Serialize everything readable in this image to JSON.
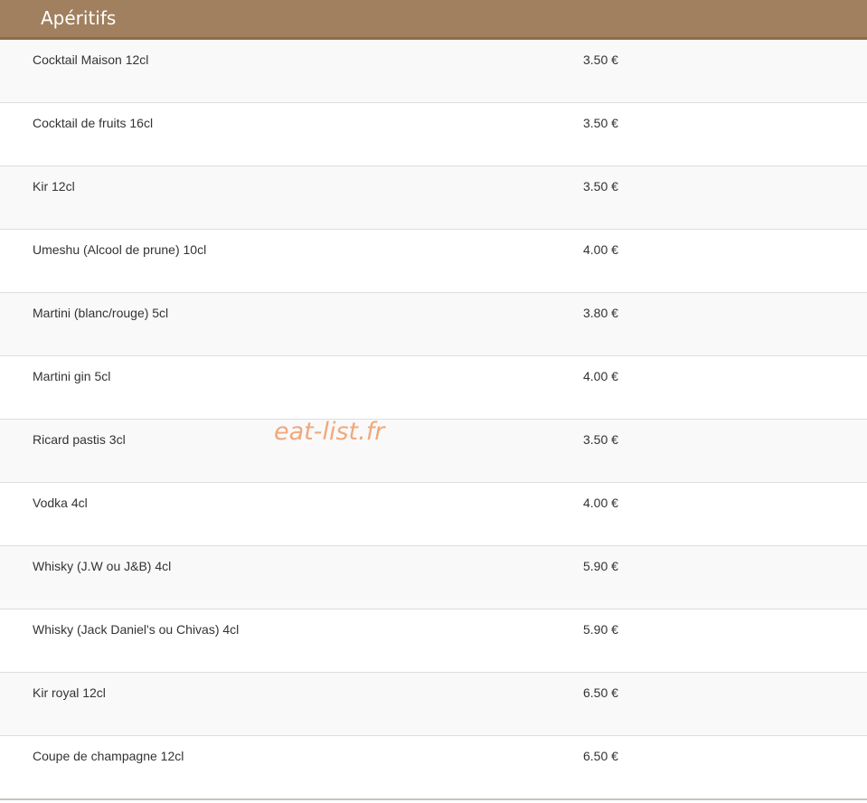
{
  "header": {
    "title": "Apéritifs"
  },
  "items": [
    {
      "name": "Cocktail Maison 12cl",
      "price": "3.50 €"
    },
    {
      "name": "Cocktail de fruits 16cl",
      "price": "3.50 €"
    },
    {
      "name": "Kir 12cl",
      "price": "3.50 €"
    },
    {
      "name": "Umeshu (Alcool de prune) 10cl",
      "price": "4.00 €"
    },
    {
      "name": "Martini (blanc/rouge) 5cl",
      "price": "3.80 €"
    },
    {
      "name": "Martini gin 5cl",
      "price": "4.00 €"
    },
    {
      "name": "Ricard pastis 3cl",
      "price": "3.50 €"
    },
    {
      "name": "Vodka 4cl",
      "price": "4.00 €"
    },
    {
      "name": "Whisky (J.W ou J&B) 4cl",
      "price": "5.90 €"
    },
    {
      "name": "Whisky (Jack Daniel's ou Chivas) 4cl",
      "price": "5.90 €"
    },
    {
      "name": "Kir royal 12cl",
      "price": "6.50 €"
    },
    {
      "name": "Coupe de champagne 12cl",
      "price": "6.50 €"
    }
  ],
  "watermark": "eat-list.fr"
}
